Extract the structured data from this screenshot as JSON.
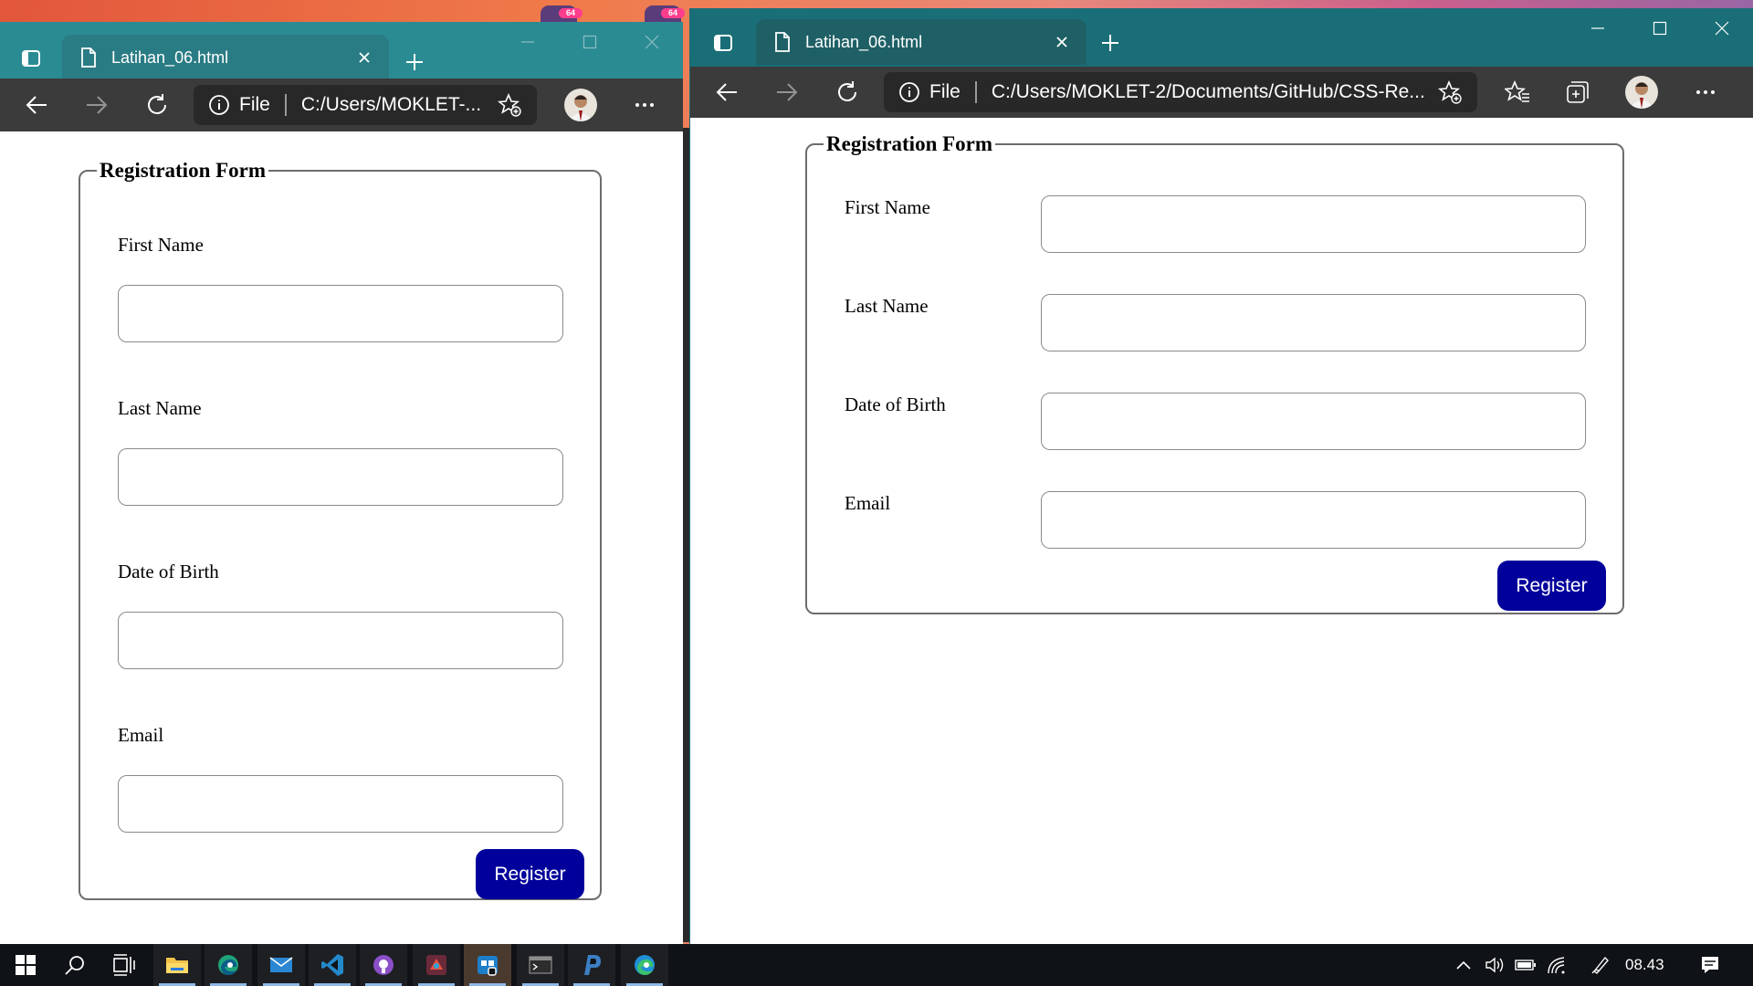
{
  "left_window": {
    "tab_title": "Latihan_06.html",
    "address_scheme": "File",
    "address_url": "C:/Users/MOKLET-...",
    "form": {
      "legend": "Registration Form",
      "fields": [
        {
          "label": "First Name",
          "value": ""
        },
        {
          "label": "Last Name",
          "value": ""
        },
        {
          "label": "Date of Birth",
          "value": ""
        },
        {
          "label": "Email",
          "value": ""
        }
      ],
      "submit_label": "Register"
    }
  },
  "right_window": {
    "tab_title": "Latihan_06.html",
    "address_scheme": "File",
    "address_url": "C:/Users/MOKLET-2/Documents/GitHub/CSS-Re...",
    "form": {
      "legend": "Registration Form",
      "fields": [
        {
          "label": "First Name",
          "value": ""
        },
        {
          "label": "Last Name",
          "value": ""
        },
        {
          "label": "Date of Birth",
          "value": ""
        },
        {
          "label": "Email",
          "value": ""
        }
      ],
      "submit_label": "Register"
    }
  },
  "wallpaper_badges": [
    "64",
    "64"
  ],
  "taskbar": {
    "clock": "08.43",
    "apps": [
      "start",
      "search",
      "task-view",
      "file-explorer",
      "edge-dev",
      "mail",
      "vscode",
      "github-desktop",
      "game-app",
      "store-app",
      "terminal",
      "php-storm",
      "edge"
    ]
  },
  "colors": {
    "titlebar_active": "#1a6e77",
    "titlebar_inactive": "#2b8b93",
    "toolbar": "#3b3b3b",
    "register_button": "#01009b"
  }
}
